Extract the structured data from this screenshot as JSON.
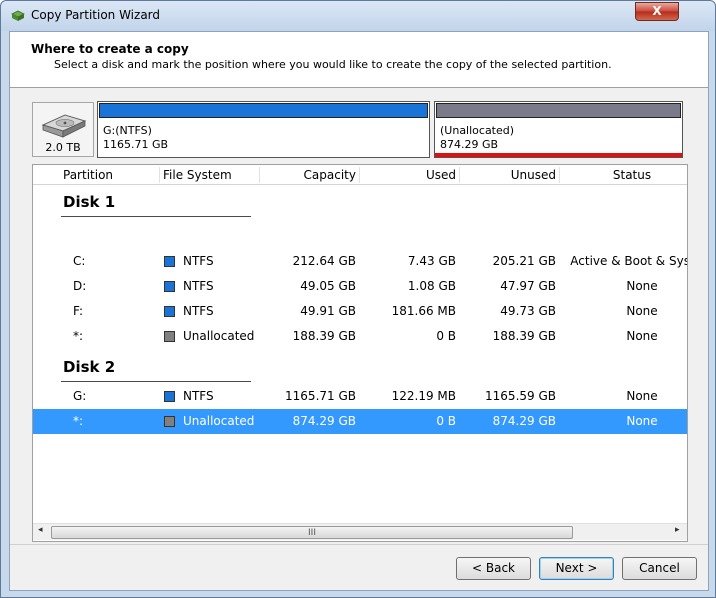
{
  "window": {
    "title": "Copy Partition Wizard",
    "close_glyph": "X"
  },
  "header": {
    "title": "Where to create a copy",
    "subtitle": "Select a disk and mark the position where you would like to create the copy of the selected partition."
  },
  "disk_map": {
    "disk_icon": "hard-disk-icon",
    "disk_capacity": "2.0 TB",
    "partitions": [
      {
        "label": "G:(NTFS)",
        "size": "1165.71 GB",
        "bar_color": "#1a73d6",
        "selected": false
      },
      {
        "label": "(Unallocated)",
        "size": "874.29 GB",
        "bar_color": "#7a7a8a",
        "selected": true
      }
    ]
  },
  "table": {
    "columns": [
      "Partition",
      "File System",
      "Capacity",
      "Used",
      "Unused",
      "Status"
    ],
    "disks": [
      {
        "name": "Disk 1",
        "rows": [
          {
            "partition": "C:",
            "fs": "NTFS",
            "fs_color": "#1a73d6",
            "capacity": "212.64 GB",
            "used": "7.43 GB",
            "unused": "205.21 GB",
            "status": "Active & Boot & System"
          },
          {
            "partition": "D:",
            "fs": "NTFS",
            "fs_color": "#1a73d6",
            "capacity": "49.05 GB",
            "used": "1.08 GB",
            "unused": "47.97 GB",
            "status": "None"
          },
          {
            "partition": "F:",
            "fs": "NTFS",
            "fs_color": "#1a73d6",
            "capacity": "49.91 GB",
            "used": "181.66 MB",
            "unused": "49.73 GB",
            "status": "None"
          },
          {
            "partition": "*:",
            "fs": "Unallocated",
            "fs_color": "#808080",
            "capacity": "188.39 GB",
            "used": "0 B",
            "unused": "188.39 GB",
            "status": "None"
          }
        ]
      },
      {
        "name": "Disk 2",
        "rows": [
          {
            "partition": "G:",
            "fs": "NTFS",
            "fs_color": "#1a73d6",
            "capacity": "1165.71 GB",
            "used": "122.19 MB",
            "unused": "1165.59 GB",
            "status": "None"
          },
          {
            "partition": "*:",
            "fs": "Unallocated",
            "fs_color": "#808080",
            "capacity": "874.29 GB",
            "used": "0 B",
            "unused": "874.29 GB",
            "status": "None",
            "selected": true
          }
        ]
      }
    ],
    "scrollbar": {
      "left_arrow": "◂",
      "right_arrow": "▸",
      "grip": "III"
    }
  },
  "buttons": {
    "back": "< Back",
    "next": "Next >",
    "cancel": "Cancel"
  }
}
